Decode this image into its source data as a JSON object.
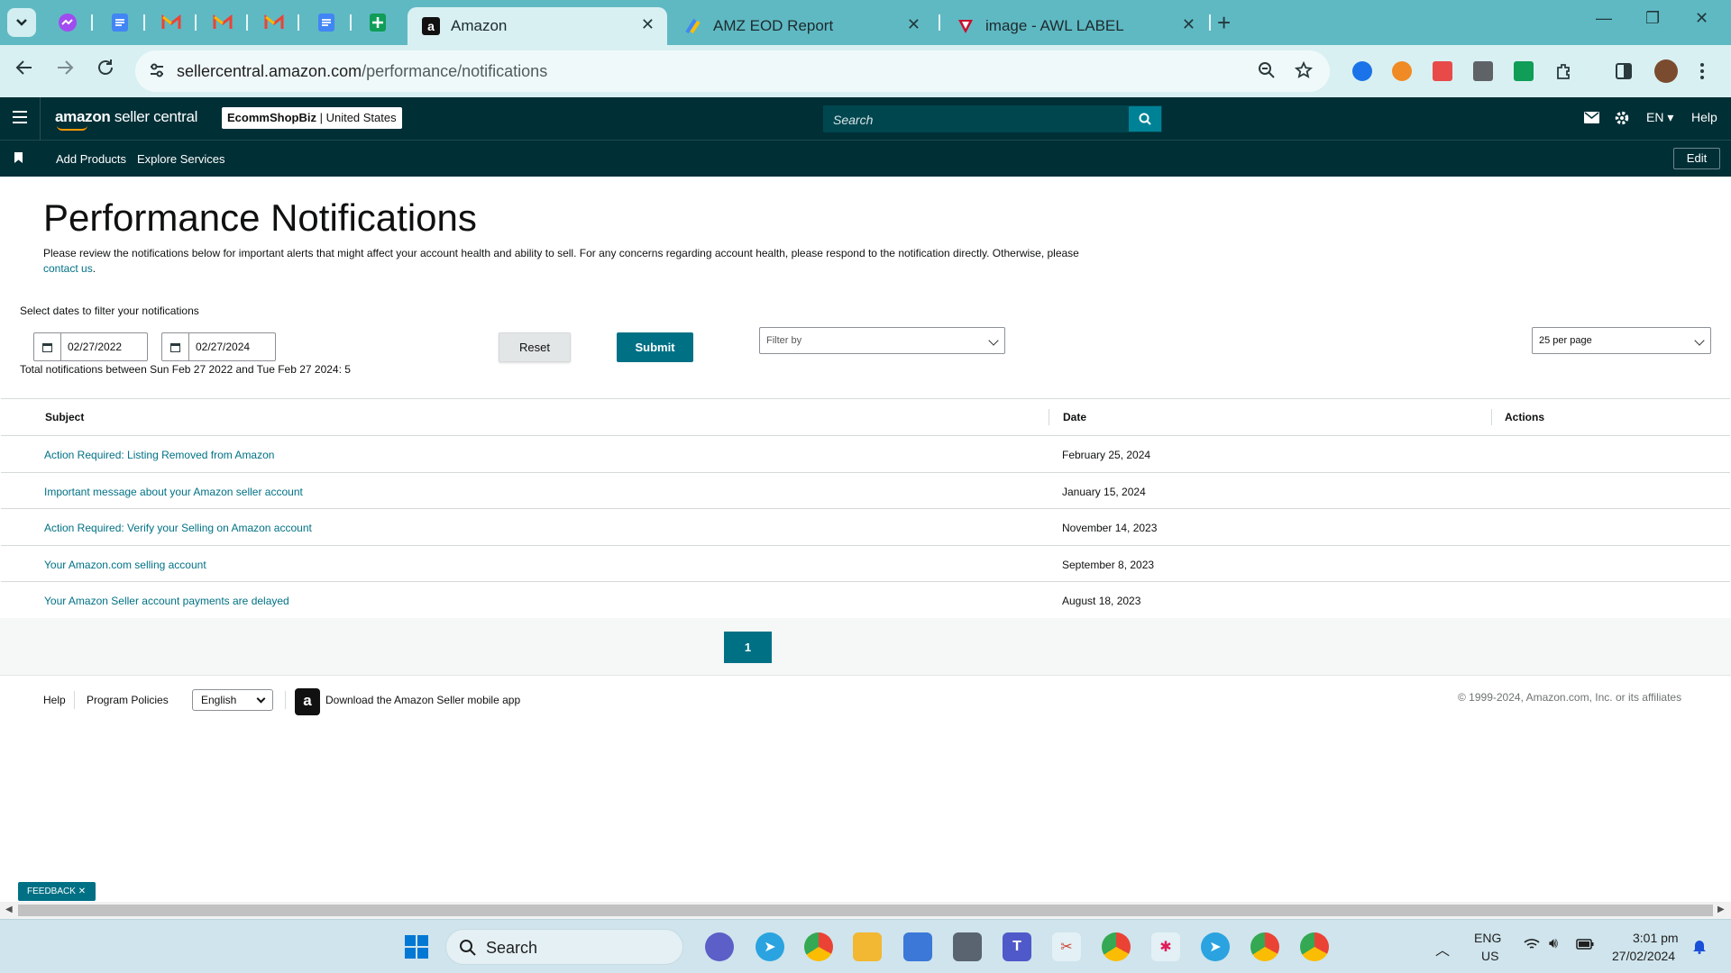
{
  "browser": {
    "tabs": [
      {
        "title": "Amazon",
        "active": true
      },
      {
        "title": "AMZ EOD Report",
        "active": false
      },
      {
        "title": "image - AWL LABEL",
        "active": false
      }
    ],
    "url_host": "sellercentral.amazon.com",
    "url_path": "/performance/notifications"
  },
  "header": {
    "logo_brand": "amazon",
    "logo_suffix": " seller central",
    "store_name": "EcommShopBiz",
    "store_region": " | United States",
    "search_placeholder": "Search",
    "language": "EN",
    "help": "Help"
  },
  "subnav": {
    "links": [
      "Add Products",
      "Explore Services"
    ],
    "edit": "Edit"
  },
  "page": {
    "title": "Performance Notifications",
    "description": "Please review the notifications below for important alerts that might affect your account health and ability to sell. For any concerns regarding account health, please respond to the notification directly. Otherwise, please",
    "contact_link": "contact us",
    "filter_label": "Select dates to filter your notifications",
    "date_from": "02/27/2022",
    "date_to": "02/27/2024",
    "reset": "Reset",
    "submit": "Submit",
    "filter_by": "Filter by",
    "per_page": "25 per page",
    "total_text": "Total notifications between Sun Feb 27 2022 and Tue Feb 27 2024: 5"
  },
  "table": {
    "headers": [
      "Subject",
      "Date",
      "Actions"
    ],
    "rows": [
      {
        "subject": "Action Required: Listing Removed from Amazon",
        "date": "February 25, 2024"
      },
      {
        "subject": "Important message about your Amazon seller account",
        "date": "January 15, 2024"
      },
      {
        "subject": "Action Required: Verify your Selling on Amazon account",
        "date": "November 14, 2023"
      },
      {
        "subject": "Your Amazon.com selling account",
        "date": "September 8, 2023"
      },
      {
        "subject": "Your Amazon Seller account payments are delayed",
        "date": "August 18, 2023"
      }
    ]
  },
  "pagination": {
    "current": "1"
  },
  "footer": {
    "help": "Help",
    "policies": "Program Policies",
    "language": "English",
    "app": "Download the Amazon Seller mobile app",
    "copyright": "© 1999-2024, Amazon.com, Inc. or its affiliates"
  },
  "feedback": "FEEDBACK",
  "taskbar": {
    "search": "Search",
    "lang1": "ENG",
    "lang2": "US",
    "time": "3:01 pm",
    "date": "27/02/2024"
  },
  "colors": {
    "brand_dark": "#002f36",
    "accent_teal": "#007185",
    "link": "#007185",
    "tabbar": "#5fb9c3"
  }
}
